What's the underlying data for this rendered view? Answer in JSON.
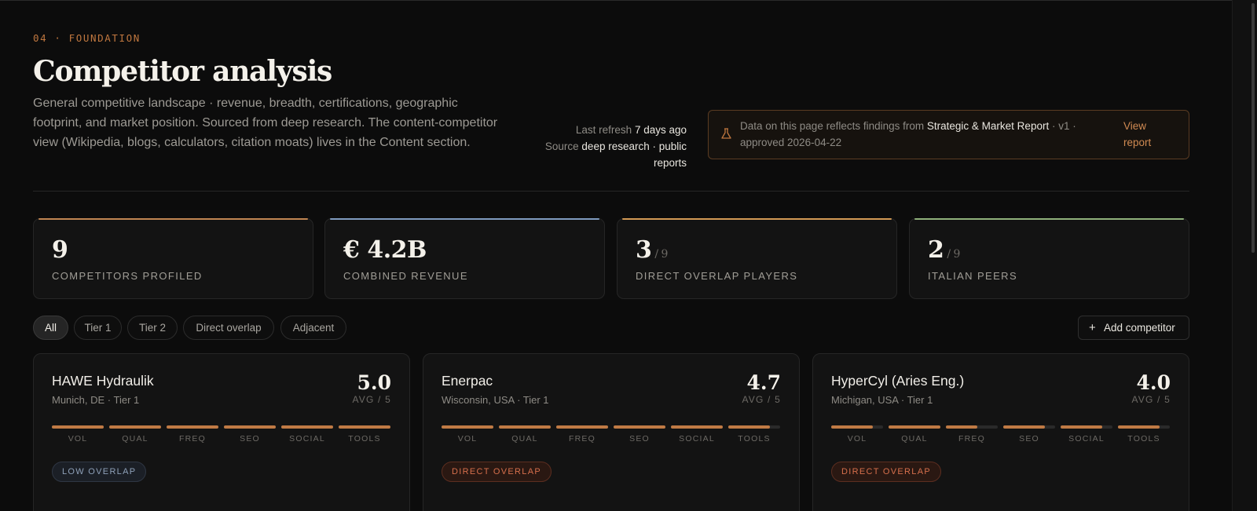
{
  "header": {
    "eyebrow": "04 · FOUNDATION",
    "title": "Competitor analysis",
    "description": "General competitive landscape · revenue, breadth, certifications, geographic footprint, and market position. Sourced from deep research. The content-competitor view (Wikipedia, blogs, calculators, citation moats) lives in the Content section."
  },
  "meta": {
    "refresh_label": "Last refresh",
    "refresh_value": "7 days ago",
    "source_label": "Source",
    "source_value": "deep research · public reports"
  },
  "notice": {
    "icon": "flask-icon",
    "prefix": "Data on this page reflects findings from",
    "report_name": "Strategic & Market Report",
    "suffix": "· v1 · approved 2026-04-22",
    "link": "View report"
  },
  "stats": [
    {
      "value": "9",
      "sub": "",
      "label": "COMPETITORS PROFILED",
      "accent": "#c08552"
    },
    {
      "value": "€ 4.2B",
      "sub": "",
      "label": "COMBINED REVENUE",
      "accent": "#7f9bbf"
    },
    {
      "value": "3",
      "sub": "/ 9",
      "label": "DIRECT OVERLAP PLAYERS",
      "accent": "#d39a55"
    },
    {
      "value": "2",
      "sub": "/ 9",
      "label": "ITALIAN PEERS",
      "accent": "#8fb07a"
    }
  ],
  "filters": [
    "All",
    "Tier 1",
    "Tier 2",
    "Direct overlap",
    "Adjacent"
  ],
  "active_filter": "All",
  "add_button": "Add competitor",
  "metric_labels": [
    "VOL",
    "QUAL",
    "FREQ",
    "SEO",
    "SOCIAL",
    "TOOLS"
  ],
  "cards": [
    {
      "name": "HAWE Hydraulik",
      "location": "Munich, DE · Tier 1",
      "score": "5.0",
      "avg": "AVG / 5",
      "metrics": [
        1,
        1,
        1,
        1,
        1,
        1
      ],
      "badge": "LOW OVERLAP",
      "badge_type": "low"
    },
    {
      "name": "Enerpac",
      "location": "Wisconsin, USA · Tier 1",
      "score": "4.7",
      "avg": "AVG / 5",
      "metrics": [
        1,
        1,
        1,
        1,
        1,
        0.8
      ],
      "badge": "DIRECT OVERLAP",
      "badge_type": "direct"
    },
    {
      "name": "HyperCyl (Aries Eng.)",
      "location": "Michigan, USA · Tier 1",
      "score": "4.0",
      "avg": "AVG / 5",
      "metrics": [
        0.8,
        1,
        0.6,
        0.8,
        0.8,
        0.8
      ],
      "badge": "DIRECT OVERLAP",
      "badge_type": "direct"
    }
  ],
  "colors": {
    "accent": "#c0773f",
    "bar_fill": "#c07a44",
    "background": "#0c0c0c"
  }
}
